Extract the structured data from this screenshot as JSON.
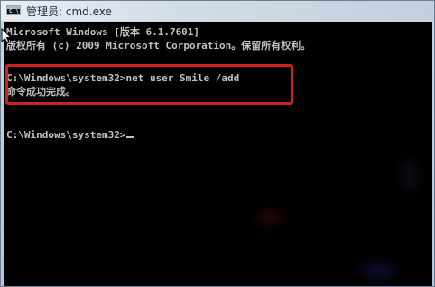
{
  "window": {
    "title": "管理员: cmd.exe",
    "app_icon": "cmd-icon",
    "app_icon_glyph": "C:\\"
  },
  "console": {
    "lines": [
      "Microsoft Windows [版本 6.1.7601]",
      "版权所有 (c) 2009 Microsoft Corporation。保留所有权利。",
      "",
      "C:\\Windows\\system32>net user Smile /add",
      "命令成功完成。",
      "",
      "",
      "C:\\Windows\\system32>"
    ],
    "text_color": "#c0c0c0",
    "background": "#000000"
  },
  "annotation": {
    "highlight_color": "#d22020"
  }
}
